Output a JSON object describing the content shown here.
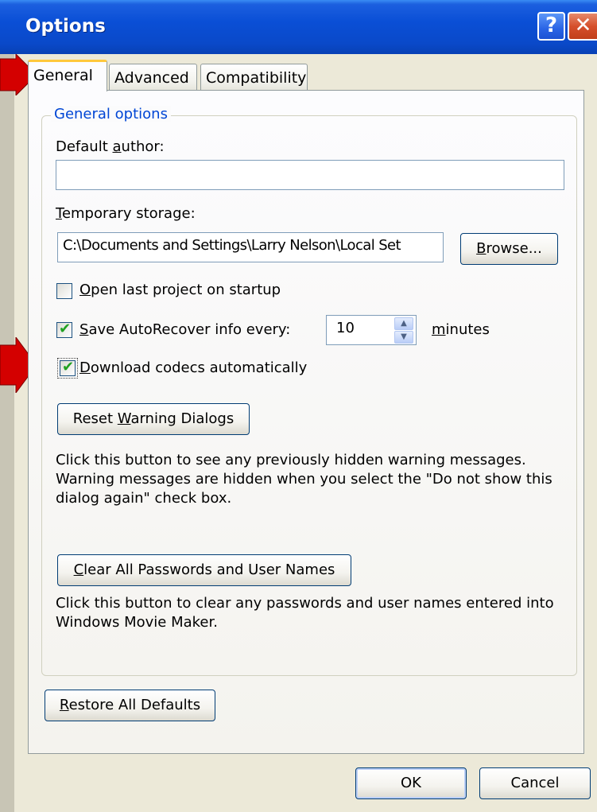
{
  "window": {
    "title": "Options",
    "help_glyph": "?",
    "close_glyph": "✕"
  },
  "tabs": [
    {
      "label": "General",
      "active": true
    },
    {
      "label": "Advanced",
      "active": false
    },
    {
      "label": "Compatibility",
      "active": false
    }
  ],
  "general": {
    "group_title": "General options",
    "default_author": {
      "label_pre": "Default ",
      "label_accel": "a",
      "label_post": "uthor:",
      "value": ""
    },
    "temp_storage": {
      "label_accel": "T",
      "label_post": "emporary storage:",
      "value": "C:\\Documents and Settings\\Larry Nelson\\Local Set",
      "browse_accel": "B",
      "browse_post": "rowse..."
    },
    "open_last": {
      "accel": "O",
      "label": "pen last project on startup",
      "checked": false
    },
    "autorecover": {
      "accel": "S",
      "label": "ave AutoRecover info every:",
      "checked": true,
      "value": "10",
      "unit_accel": "m",
      "unit": "inutes"
    },
    "codecs": {
      "accel": "D",
      "label": "ownload codecs automatically",
      "checked": true
    },
    "reset_warning": {
      "label_pre": "Reset ",
      "accel": "W",
      "label_post": "arning Dialogs",
      "description": "Click this button to see any previously hidden warning messages. Warning messages are hidden when you select the \"Do not show this dialog again\" check box."
    },
    "clear_passwords": {
      "accel": "C",
      "label_post": "lear All Passwords and User Names",
      "description": "Click this button to clear any passwords and user names entered into Windows Movie Maker."
    },
    "restore_defaults": {
      "accel": "R",
      "label_post": "estore All Defaults"
    }
  },
  "footer": {
    "ok": "OK",
    "cancel": "Cancel"
  },
  "colors": {
    "titlebar": "#0a4fd6",
    "accent": "#0046d5",
    "arrow": "#d40000"
  }
}
